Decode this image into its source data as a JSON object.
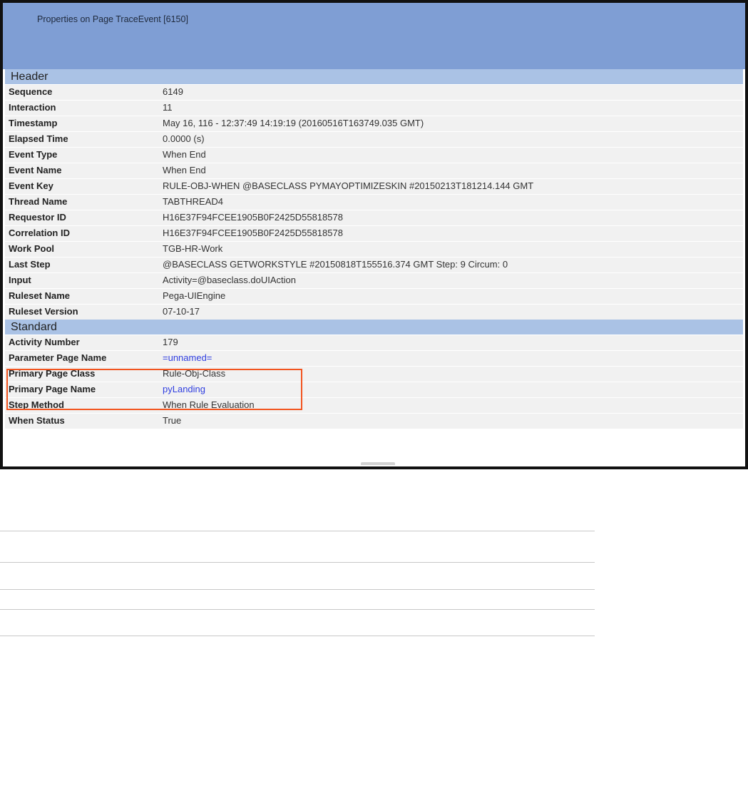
{
  "window": {
    "title": "Properties on Page TraceEvent [6150]"
  },
  "sections": [
    {
      "heading": "Header",
      "rows": [
        {
          "label": "Sequence",
          "value": "6149"
        },
        {
          "label": "Interaction",
          "value": "11"
        },
        {
          "label": "Timestamp",
          "value": "May 16, 116 - 12:37:49 14:19:19  (20160516T163749.035 GMT)"
        },
        {
          "label": "Elapsed Time",
          "value": "0.0000 (s)"
        },
        {
          "label": "Event Type",
          "value": "When End"
        },
        {
          "label": "Event Name",
          "value": "When End"
        },
        {
          "label": "Event Key",
          "value": "RULE-OBJ-WHEN @BASECLASS PYMAYOPTIMIZESKIN #20150213T181214.144 GMT"
        },
        {
          "label": "Thread Name",
          "value": "TABTHREAD4"
        },
        {
          "label": "Requestor ID",
          "value": "H16E37F94FCEE1905B0F2425D55818578"
        },
        {
          "label": "Correlation ID",
          "value": "H16E37F94FCEE1905B0F2425D55818578"
        },
        {
          "label": "Work Pool",
          "value": "TGB-HR-Work"
        },
        {
          "label": "Last Step",
          "value": "@BASECLASS GETWORKSTYLE #20150818T155516.374 GMT Step: 9 Circum: 0"
        },
        {
          "label": "Input",
          "value": "Activity=@baseclass.doUIAction"
        },
        {
          "label": "Ruleset Name",
          "value": "Pega-UIEngine"
        },
        {
          "label": "Ruleset Version",
          "value": "07-10-17"
        }
      ]
    },
    {
      "heading": "Standard",
      "rows": [
        {
          "label": "Activity Number",
          "value": "179"
        },
        {
          "label": "Parameter Page Name",
          "value": "=unnamed=",
          "link": true
        },
        {
          "label": "Primary Page Class",
          "value": "Rule-Obj-Class"
        },
        {
          "label": "Primary Page Name",
          "value": "pyLanding",
          "link": true
        },
        {
          "label": "Step Method",
          "value": "When Rule Evaluation"
        },
        {
          "label": "When Status",
          "value": "True"
        }
      ]
    }
  ],
  "colors": {
    "title_bar": "#7f9ed4",
    "section_header": "#aac2e5",
    "row_background": "#f1f1f1",
    "link": "#2f3ee0",
    "highlight": "#f2541f"
  }
}
